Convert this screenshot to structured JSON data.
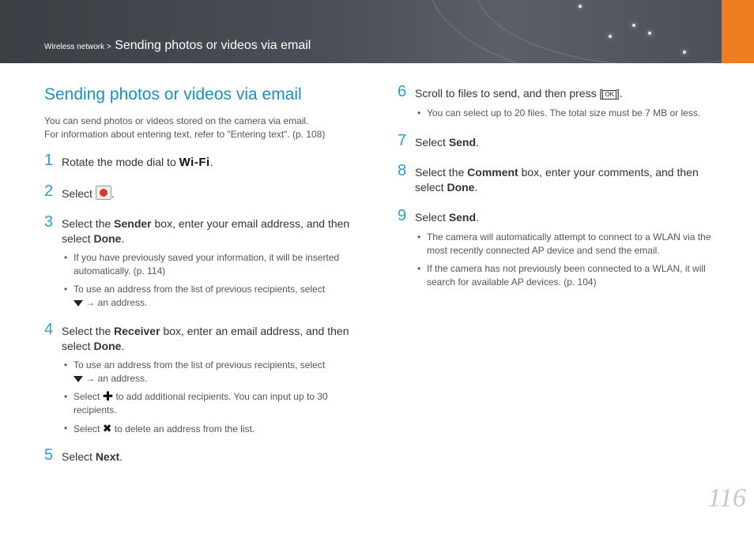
{
  "header": {
    "breadcrumb_small": "Wireless network >",
    "breadcrumb_big": "Sending photos or videos via email",
    "accent_color": "#ee7d1f"
  },
  "title": "Sending photos or videos via email",
  "intro": {
    "line1": "You can send photos or videos stored on the camera via email.",
    "line2": "For information about entering text, refer to \"Entering text\". (p. 108)"
  },
  "steps": {
    "s1": {
      "num": "1",
      "text": "Rotate the mode dial to",
      "icon_label": "Wi-Fi",
      "end": "."
    },
    "s2": {
      "num": "2",
      "text": "Select",
      "end": "."
    },
    "s3": {
      "num": "3",
      "pre": "Select the",
      "b1": "Sender",
      "mid": "box, enter your email address, and then select",
      "b2": "Done",
      "end": "."
    },
    "s4": {
      "num": "4",
      "pre": "Select the",
      "b1": "Receiver",
      "mid": "box, enter an email address, and then select",
      "b2": "Done",
      "end": "."
    },
    "s5": {
      "num": "5",
      "pre": "Select",
      "b1": "Next",
      "end": "."
    },
    "s6": {
      "num": "6",
      "text": "Scroll to files to send, and then press [",
      "ok": "OK",
      "end": "]."
    },
    "s7": {
      "num": "7",
      "pre": "Select",
      "b1": "Send",
      "end": "."
    },
    "s8": {
      "num": "8",
      "pre": "Select the",
      "b1": "Comment",
      "mid": "box, enter your comments, and then select",
      "b2": "Done",
      "end": "."
    },
    "s9": {
      "num": "9",
      "pre": "Select",
      "b1": "Send",
      "end": "."
    }
  },
  "bullets": {
    "s3a": "If you have previously saved your information, it will be inserted automatically. (p. 114)",
    "s3b_pre": "To use an address from the list of previous recipients, select",
    "s3b_post": "→ an address.",
    "s4a_pre": "To use an address from the list of previous recipients, select",
    "s4a_post": "→ an address.",
    "s4b_pre": "Select",
    "s4b_post": "to add additional recipients. You can input up to 30 recipients.",
    "s4c_pre": "Select",
    "s4c_post": "to delete an address from the list.",
    "s6a": "You can select up to 20 files. The total size must be 7 MB or less.",
    "s9a": "The camera will automatically attempt to connect to a WLAN via the most recently connected AP device and send the email.",
    "s9b": "If the camera has not previously been connected to a WLAN, it will search for available AP devices. (p. 104)"
  },
  "icons": {
    "wifi": "wifi-mode-icon",
    "email": "email-icon",
    "dropdown": "triangle-down-icon",
    "plus": "plus-icon",
    "delete": "x-icon",
    "ok": "ok-button-icon"
  },
  "page_number": "116"
}
